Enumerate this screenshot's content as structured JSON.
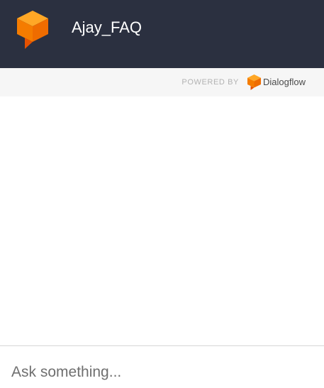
{
  "header": {
    "title": "Ajay_FAQ",
    "logo_icon": "dialogflow-cube-icon",
    "background_color": "#2b3040"
  },
  "powered_by": {
    "label": "POWERED BY",
    "brand_icon": "dialogflow-logo-icon",
    "brand_name": "Dialogflow"
  },
  "messages": [],
  "input": {
    "placeholder": "Ask something...",
    "value": ""
  },
  "colors": {
    "accent_orange": "#f28b00",
    "accent_orange_dark": "#ef6c00",
    "accent_orange_light": "#ffa726"
  }
}
